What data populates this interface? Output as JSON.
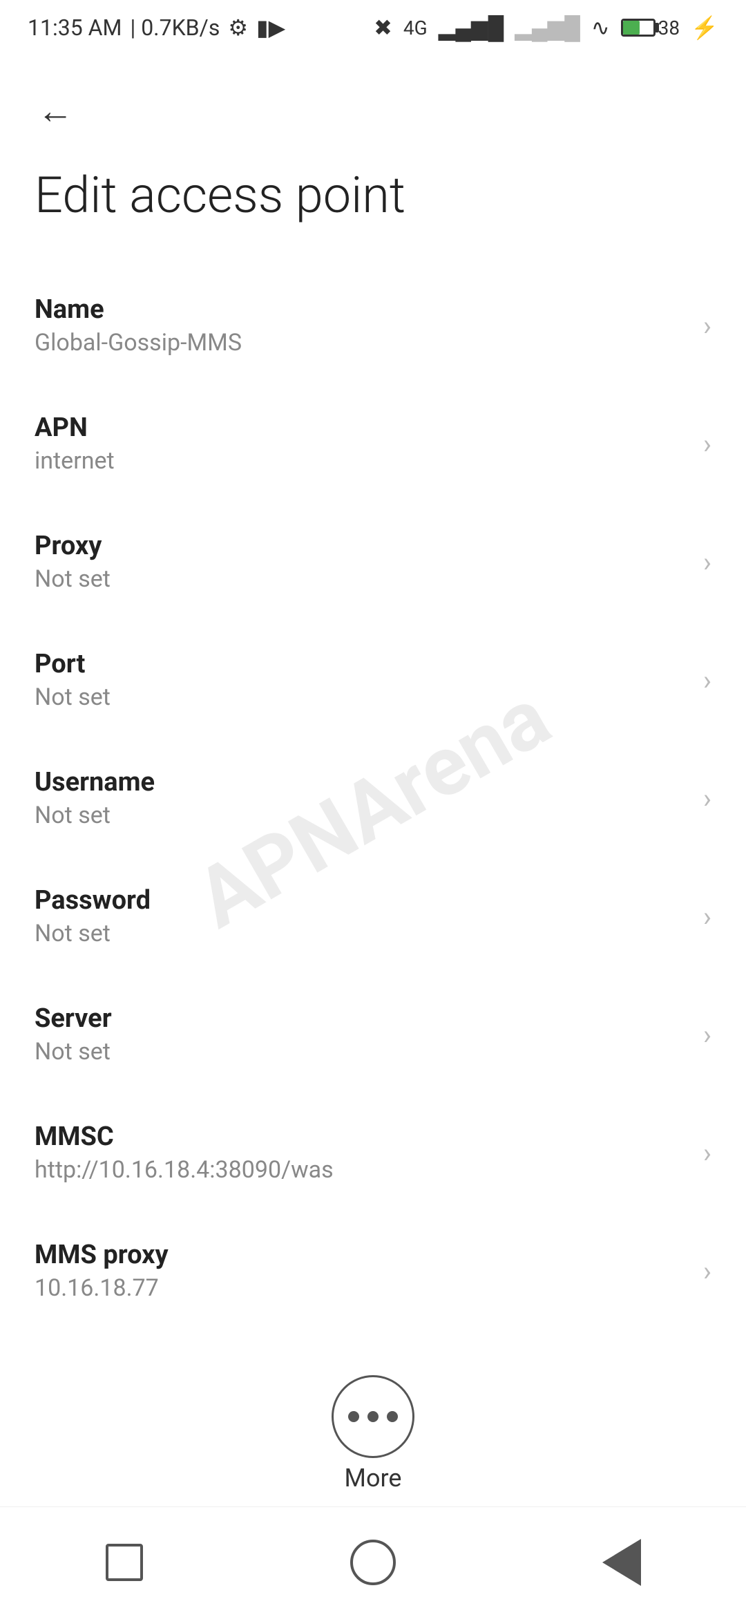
{
  "statusBar": {
    "time": "11:35 AM",
    "network": "0.7KB/s",
    "battery": "38"
  },
  "header": {
    "back_label": "←",
    "title": "Edit access point"
  },
  "settings": [
    {
      "id": "name",
      "label": "Name",
      "value": "Global-Gossip-MMS"
    },
    {
      "id": "apn",
      "label": "APN",
      "value": "internet"
    },
    {
      "id": "proxy",
      "label": "Proxy",
      "value": "Not set"
    },
    {
      "id": "port",
      "label": "Port",
      "value": "Not set"
    },
    {
      "id": "username",
      "label": "Username",
      "value": "Not set"
    },
    {
      "id": "password",
      "label": "Password",
      "value": "Not set"
    },
    {
      "id": "server",
      "label": "Server",
      "value": "Not set"
    },
    {
      "id": "mmsc",
      "label": "MMSC",
      "value": "http://10.16.18.4:38090/was"
    },
    {
      "id": "mms-proxy",
      "label": "MMS proxy",
      "value": "10.16.18.77"
    }
  ],
  "more": {
    "label": "More"
  },
  "watermark": "APNArena"
}
